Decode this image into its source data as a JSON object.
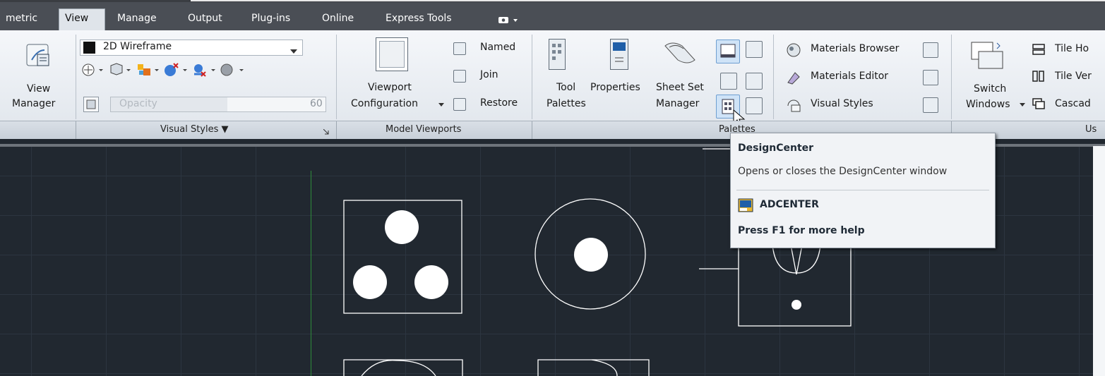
{
  "tabs": [
    {
      "label": "metric",
      "active": false
    },
    {
      "label": "View",
      "active": true
    },
    {
      "label": "Manage",
      "active": false
    },
    {
      "label": "Output",
      "active": false
    },
    {
      "label": "Plug-ins",
      "active": false
    },
    {
      "label": "Online",
      "active": false
    },
    {
      "label": "Express Tools",
      "active": false
    }
  ],
  "tab_extra_icon": "camera-dropdown-icon",
  "view_manager": {
    "line1": "View",
    "line2": "Manager"
  },
  "visual_styles": {
    "style_value": "2D Wireframe",
    "opacity_label": "Opacity",
    "opacity_value": "60",
    "panel_title": "Visual Styles ▼"
  },
  "model_viewports": {
    "config_line1": "Viewport",
    "config_line2": "Configuration",
    "named": "Named",
    "join": "Join",
    "restore": "Restore",
    "panel_title": "Model Viewports"
  },
  "palettes": {
    "tool_line1": "Tool",
    "tool_line2": "Palettes",
    "properties": "Properties",
    "sheetset_line1": "Sheet Set",
    "sheetset_line2": "Manager",
    "materials_browser": "Materials Browser",
    "materials_editor": "Materials Editor",
    "visual_styles": "Visual Styles",
    "panel_title": "Palettes"
  },
  "windows": {
    "switch_line1": "Switch",
    "switch_line2": "Windows",
    "tile_horizontal": "Tile Ho",
    "tile_vertical": "Tile Ver",
    "cascade": "Cascad",
    "panel_title": "Us"
  },
  "tooltip": {
    "title": "DesignCenter",
    "description": "Opens or closes the DesignCenter window",
    "command": "ADCENTER",
    "help": "Press F1 for more help"
  },
  "colors": {
    "canvas": "#212830",
    "ribbon": "#e9edf2",
    "tab_bar": "#4a4e55",
    "highlight": "#cfe3f7"
  }
}
